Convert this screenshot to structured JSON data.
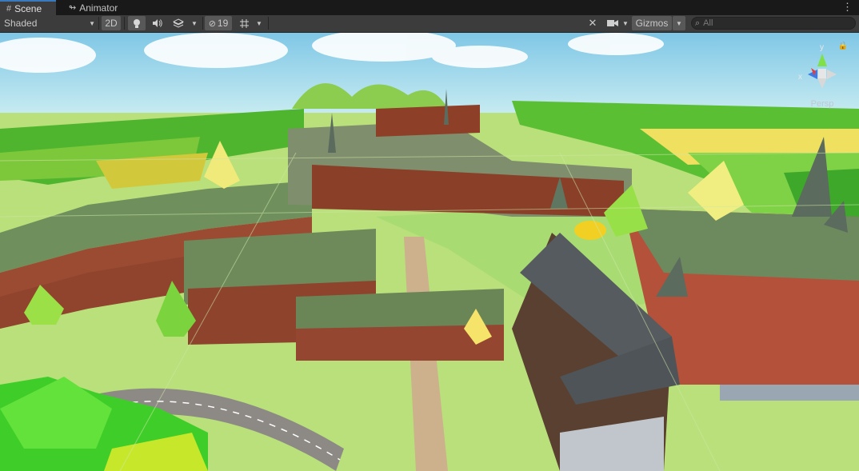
{
  "tabs": [
    {
      "label": "Scene",
      "icon": "scene-grid-icon",
      "active": true
    },
    {
      "label": "Animator",
      "icon": "animator-icon",
      "active": false
    }
  ],
  "toolbar": {
    "shading_mode": "Shaded",
    "two_d_label": "2D",
    "hidden_count": "19",
    "gizmos_label": "Gizmos",
    "search_placeholder": "All"
  },
  "viewport": {
    "projection_label": "Persp",
    "axis_label_y": "y",
    "axis_label_x": "x",
    "sky_color": "#9fd8ea",
    "ground_color": "#b9e07a"
  }
}
